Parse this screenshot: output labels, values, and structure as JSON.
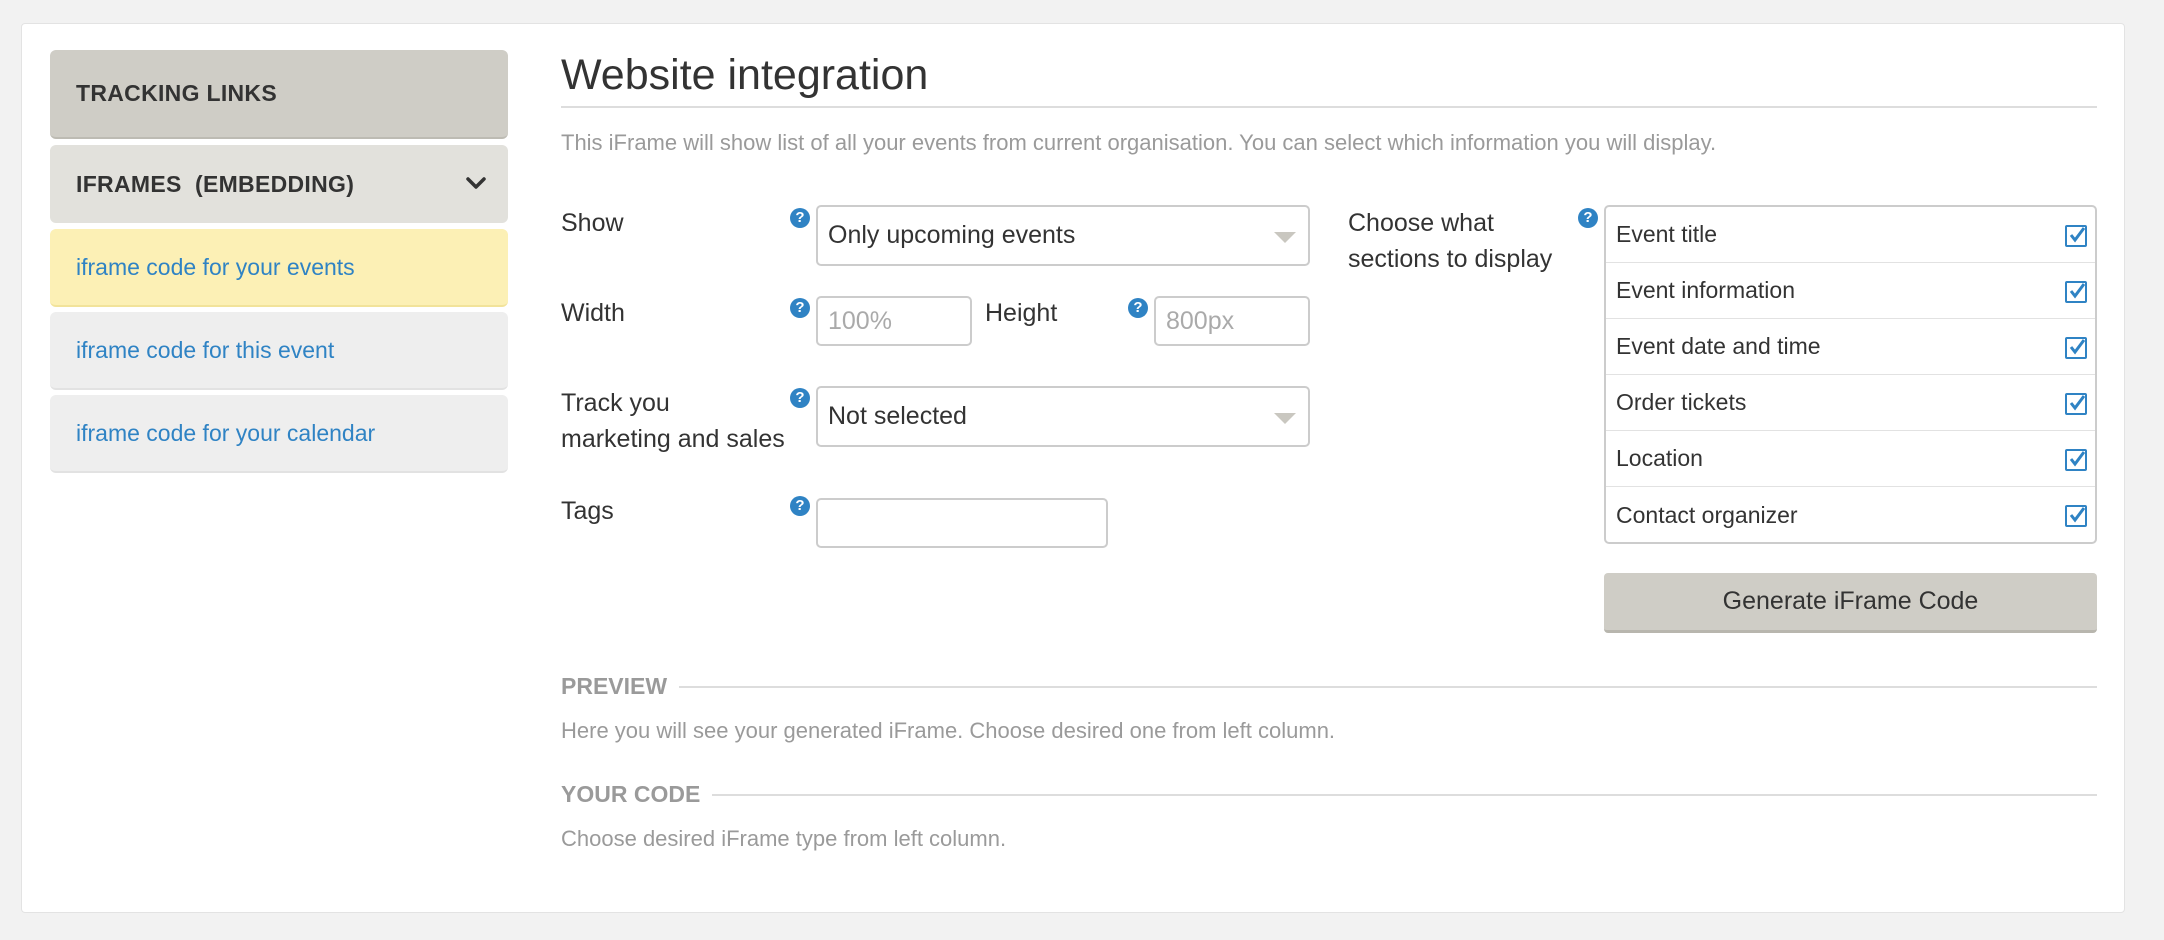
{
  "sidebar": {
    "tracking_links": "TRACKING LINKS",
    "iframes": "IFRAMES  (EMBEDDING)",
    "items": [
      {
        "label": "iframe code for your events"
      },
      {
        "label": "iframe code for this event"
      },
      {
        "label": "iframe code for your calendar"
      }
    ]
  },
  "main": {
    "title": "Website integration",
    "intro": "This iFrame will show list of all your events from current organisation. You can select which information you will display.",
    "form": {
      "show_label": "Show",
      "show_value": "Only upcoming events",
      "width_label": "Width",
      "width_placeholder": "100%",
      "height_label": "Height",
      "height_placeholder": "800px",
      "track_label_line1": "Track you",
      "track_label_line2": "marketing and sales",
      "track_value": "Not selected",
      "tags_label": "Tags",
      "tags_value": "",
      "sections_label_line1": "Choose what",
      "sections_label_line2": "sections to display",
      "help_glyph": "?"
    },
    "sections": [
      {
        "label": "Event title",
        "checked": true
      },
      {
        "label": "Event information",
        "checked": true
      },
      {
        "label": "Event date and time",
        "checked": true
      },
      {
        "label": "Order tickets",
        "checked": true
      },
      {
        "label": "Location",
        "checked": true
      },
      {
        "label": "Contact organizer",
        "checked": true
      }
    ],
    "generate_button": "Generate iFrame Code",
    "preview": {
      "heading": "PREVIEW",
      "text": "Here you will see your generated iFrame. Choose desired one from left column."
    },
    "your_code": {
      "heading": "YOUR CODE",
      "text": "Choose desired iFrame type from left column."
    }
  },
  "colors": {
    "accent": "#2f83c4",
    "active_item": "#fcf0b5",
    "button_bg": "#cfcdc6"
  },
  "icons": [
    "chevron-down-icon",
    "help-icon",
    "checkbox-checked-icon",
    "dropdown-caret-icon"
  ]
}
